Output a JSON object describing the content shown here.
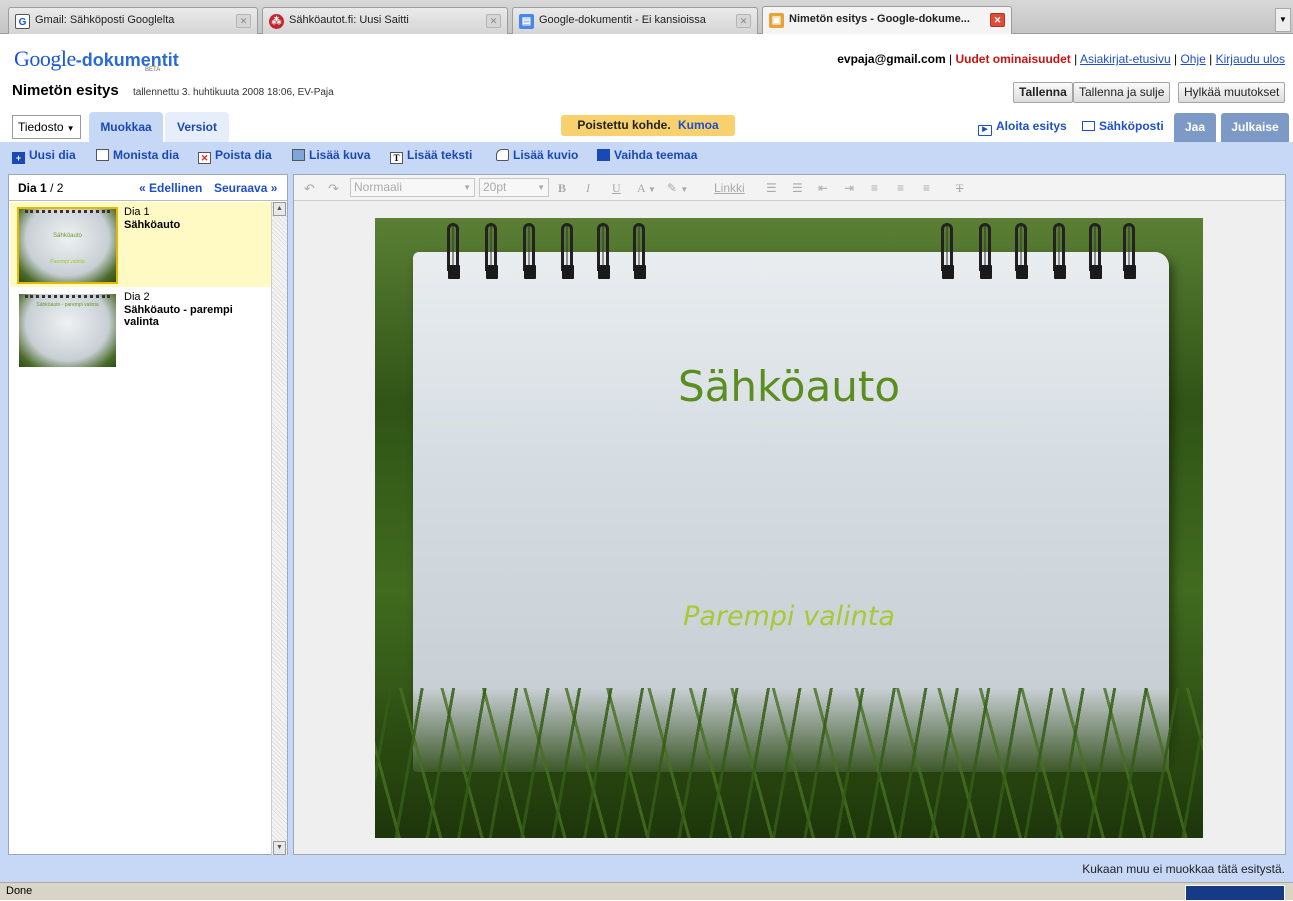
{
  "browser": {
    "tabs": [
      {
        "label": "Gmail: Sähköposti Googlelta",
        "icon": "gmail-icon",
        "active": false
      },
      {
        "label": "Sähköautot.fi: Uusi Saitti",
        "icon": "site-icon",
        "active": false
      },
      {
        "label": "Google-dokumentit - Ei kansioissa",
        "icon": "docs-icon",
        "active": false
      },
      {
        "label": "Nimetön esitys - Google-dokume...",
        "icon": "presentation-icon",
        "active": true
      }
    ]
  },
  "header": {
    "logo_google": "Google",
    "logo_product": "-dokumentit",
    "logo_beta": "BETA",
    "user_email": "evpaja@gmail.com",
    "new_features": "Uudet ominaisuudet",
    "links": [
      "Asiakirjat-etusivu",
      "Ohje",
      "Kirjaudu ulos"
    ],
    "separator": "|"
  },
  "document": {
    "title": "Nimetön esitys",
    "saved_info": "tallennettu 3. huhtikuuta 2008 18:06, EV-Paja",
    "save_label": "Tallenna",
    "save_close_label": "Tallenna ja sulje",
    "discard_label": "Hylkää muutokset"
  },
  "menubar": {
    "file_label": "Tiedosto",
    "tab_edit": "Muokkaa",
    "tab_versions": "Versiot",
    "notification": "Poistettu kohde.",
    "undo_label": "Kumoa",
    "start_presentation": "Aloita esitys",
    "email_label": "Sähköposti",
    "share_label": "Jaa",
    "publish_label": "Julkaise"
  },
  "slide_toolbar": {
    "new_slide": "Uusi dia",
    "duplicate_slide": "Monista dia",
    "delete_slide": "Poista dia",
    "insert_image": "Lisää kuva",
    "insert_text": "Lisää teksti",
    "insert_shape": "Lisää kuvio",
    "change_theme": "Vaihda teemaa"
  },
  "slide_panel": {
    "counter_prefix": "Dia",
    "current": "1",
    "total": "/ 2",
    "prev_label": "« Edellinen",
    "next_label": "Seuraava »",
    "slides": [
      {
        "number": "Dia 1",
        "title": "Sähköauto",
        "thumb_title": "Sähköauto",
        "thumb_sub": "Parempi valinta",
        "selected": true
      },
      {
        "number": "Dia 2",
        "title": "Sähköauto - parempi valinta",
        "thumb_title": "Sähköauto - parempi valinta",
        "thumb_sub": "",
        "selected": false
      }
    ]
  },
  "format_bar": {
    "style_value": "Normaali",
    "size_value": "20pt",
    "bold": "B",
    "italic": "I",
    "underline": "U",
    "text_color": "A",
    "link_label": "Linkki"
  },
  "slide": {
    "title": "Sähköauto",
    "subtitle": "Parempi valinta",
    "title_color": "#5a8e1f",
    "subtitle_color": "#a9c833"
  },
  "footer": {
    "edit_status": "Kukaan muu ei muokkaa tätä esitystä.",
    "browser_status": "Done"
  },
  "colors": {
    "workarea": "#c7d8f7",
    "link": "#1f4fc7",
    "notification": "#f8d06e",
    "share_button": "#7d99c5"
  }
}
